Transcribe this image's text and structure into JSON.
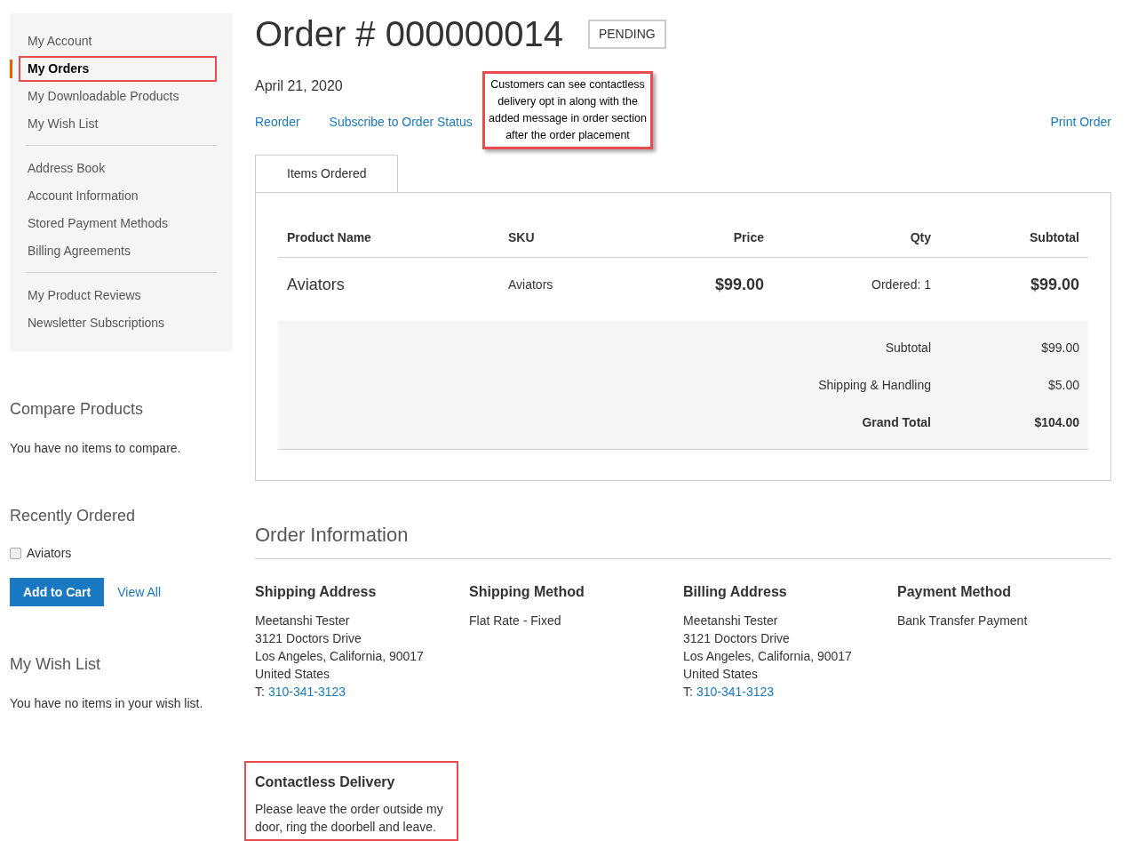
{
  "sidebar": {
    "groups": [
      [
        {
          "label": "My Account",
          "selected": false,
          "highlighted": false
        },
        {
          "label": "My Orders",
          "selected": true,
          "highlighted": true
        },
        {
          "label": "My Downloadable Products",
          "selected": false,
          "highlighted": false
        },
        {
          "label": "My Wish List",
          "selected": false,
          "highlighted": false
        }
      ],
      [
        {
          "label": "Address Book",
          "selected": false,
          "highlighted": false
        },
        {
          "label": "Account Information",
          "selected": false,
          "highlighted": false
        },
        {
          "label": "Stored Payment Methods",
          "selected": false,
          "highlighted": false
        },
        {
          "label": "Billing Agreements",
          "selected": false,
          "highlighted": false
        }
      ],
      [
        {
          "label": "My Product Reviews",
          "selected": false,
          "highlighted": false
        },
        {
          "label": "Newsletter Subscriptions",
          "selected": false,
          "highlighted": false
        }
      ]
    ]
  },
  "compare": {
    "title": "Compare Products",
    "text": "You have no items to compare."
  },
  "recently_ordered": {
    "title": "Recently Ordered",
    "items": [
      {
        "label": "Aviators",
        "checked": false
      }
    ],
    "add_button": "Add to Cart",
    "view_all": "View All"
  },
  "wish_list": {
    "title": "My Wish List",
    "text": "You have no items in your wish list."
  },
  "order": {
    "title": "Order # 000000014",
    "status": "PENDING",
    "date": "April 21, 2020",
    "actions": [
      "Reorder",
      "Subscribe to Order Status"
    ],
    "print": "Print Order"
  },
  "callout": "Customers can see contactless delivery opt in along with the added message in order section after the order placement",
  "tabs": [
    {
      "label": "Items Ordered",
      "selected": true
    }
  ],
  "table": {
    "columns": [
      "Product Name",
      "SKU",
      "Price",
      "Qty",
      "Subtotal"
    ],
    "rows": [
      [
        "Aviators",
        "Aviators",
        "$99.00",
        "Ordered: 1",
        "$99.00"
      ]
    ],
    "totals": [
      {
        "label": "Subtotal",
        "value": "$99.00",
        "bold": false
      },
      {
        "label": "Shipping & Handling",
        "value": "$5.00",
        "bold": false
      },
      {
        "label": "Grand Total",
        "value": "$104.00",
        "bold": true
      }
    ]
  },
  "order_information": {
    "title": "Order Information",
    "blocks": [
      {
        "title": "Shipping Address",
        "lines": [
          "Meetanshi Tester",
          "3121 Doctors Drive",
          "Los Angeles, California, 90017",
          "United States"
        ],
        "phone_prefix": "T:",
        "phone": "310-341-3123"
      },
      {
        "title": "Shipping Method",
        "lines": [
          "Flat Rate - Fixed"
        ]
      },
      {
        "title": "Billing Address",
        "lines": [
          "Meetanshi Tester",
          "3121 Doctors Drive",
          "Los Angeles, California, 90017",
          "United States"
        ],
        "phone_prefix": "T:",
        "phone": "310-341-3123"
      },
      {
        "title": "Payment Method",
        "lines": [
          "Bank Transfer Payment"
        ]
      }
    ]
  },
  "contactless": {
    "title": "Contactless Delivery",
    "text": "Please leave the order outside my door, ring the doorbell and leave.",
    "highlighted": true
  }
}
